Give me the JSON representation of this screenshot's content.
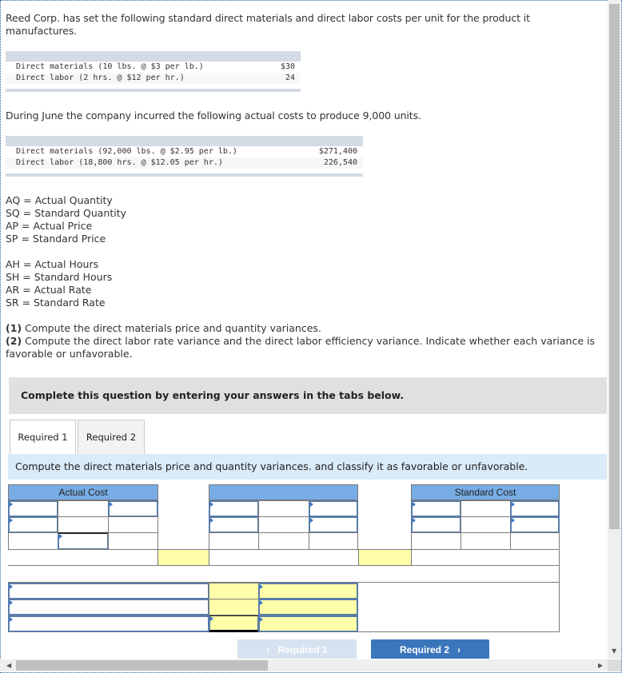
{
  "intro": "Reed Corp. has set the following standard direct materials and direct labor costs per unit for the product it manufactures.",
  "standard_costs": {
    "rows": [
      {
        "label": "Direct materials (10 lbs. @ $3 per lb.)",
        "value": "$30"
      },
      {
        "label": "Direct labor (2 hrs. @ $12 per hr.)",
        "value": "24"
      }
    ]
  },
  "actual_intro": "During June the company incurred the following actual costs to produce 9,000 units.",
  "actual_costs": {
    "rows": [
      {
        "label": "Direct materials (92,000 lbs. @ $2.95 per lb.)",
        "value": "$271,400"
      },
      {
        "label": "Direct labor (18,800 hrs. @ $12.05 per hr.)",
        "value": "226,540"
      }
    ]
  },
  "definitions_1": [
    "AQ = Actual Quantity",
    "SQ = Standard Quantity",
    "AP = Actual Price",
    "SP = Standard Price"
  ],
  "definitions_2": [
    "AH = Actual Hours",
    "SH = Standard Hours",
    "AR = Actual Rate",
    "SR = Standard Rate"
  ],
  "instructions": {
    "q1_num": "(1)",
    "q1_text": " Compute the direct materials price and quantity variances.",
    "q2_num": "(2)",
    "q2_text": " Compute the direct labor rate variance and the direct labor efficiency variance. Indicate whether each variance is favorable or unfavorable."
  },
  "banner": "Complete this question by entering your answers in the tabs below.",
  "tabs": [
    {
      "label": "Required 1",
      "active": true
    },
    {
      "label": "Required 2",
      "active": false
    }
  ],
  "question": "Compute the direct materials price and quantity variances. and classify it as favorable or unfavorable.",
  "grid": {
    "headers": {
      "actual": "Actual Cost",
      "middle": "",
      "standard": "Standard Cost"
    }
  },
  "nav": {
    "prev_label": "Required 1",
    "next_label": "Required 2",
    "prev_icon": "‹",
    "next_icon": "›"
  }
}
